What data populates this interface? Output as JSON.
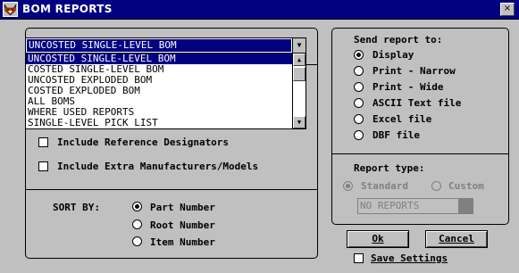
{
  "window": {
    "title": "BOM REPORTS",
    "close_glyph": "×",
    "icon": "app-fox-icon"
  },
  "report_select": {
    "selected": "UNCOSTED SINGLE-LEVEL BOM",
    "options": [
      "UNCOSTED SINGLE-LEVEL BOM",
      "COSTED SINGLE-LEVEL BOM",
      "UNCOSTED EXPLODED BOM",
      "COSTED EXPLODED BOM",
      "ALL BOMS",
      "WHERE USED REPORTS",
      "SINGLE-LEVEL PICK LIST"
    ],
    "scroll_up_glyph": "▲",
    "scroll_down_glyph": "▼",
    "arrow_glyph": "▼"
  },
  "options": {
    "include_ref_designators": "Include Reference Designators",
    "include_extra_mfr": "Include Extra Manufacturers/Models"
  },
  "sort": {
    "label": "SORT BY:",
    "options": [
      "Part Number",
      "Root Number",
      "Item Number"
    ],
    "selected_index": 0
  },
  "send_report": {
    "title": "Send report to:",
    "options": [
      "Display",
      "Print - Narrow",
      "Print - Wide",
      "ASCII Text file",
      "Excel file",
      "DBF file"
    ],
    "selected_index": 0
  },
  "report_type": {
    "title": "Report type:",
    "options": [
      "Standard",
      "Custom"
    ],
    "selected_index": 0,
    "custom_reports_value": "NO REPORTS"
  },
  "buttons": {
    "ok": "Ok",
    "cancel": "Cancel"
  },
  "save_settings": {
    "label": "Save Settings",
    "checked": false
  },
  "colors": {
    "title_bar": "#000080",
    "selection": "#000080",
    "face": "#c0c0c0"
  }
}
